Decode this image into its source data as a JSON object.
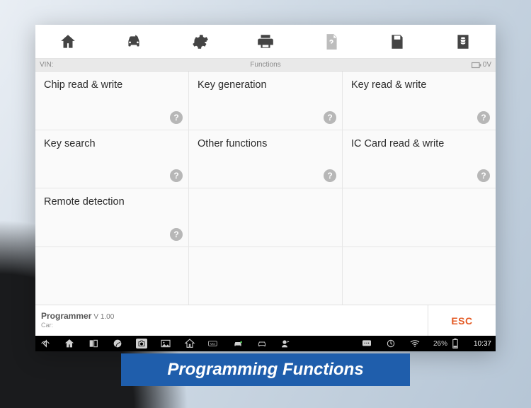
{
  "strip": {
    "vin_label": "VIN:",
    "title": "Functions",
    "voltage": "0V"
  },
  "cells": [
    "Chip read & write",
    "Key generation",
    "Key read & write",
    "Key search",
    "Other functions",
    "IC Card read & write",
    "Remote detection"
  ],
  "footer": {
    "programmer": "Programmer",
    "version": "V 1.00",
    "car_label": "Car:",
    "esc": "ESC"
  },
  "navbar": {
    "battery_pct": "26%",
    "time": "10:37"
  },
  "caption": "Programming Functions"
}
